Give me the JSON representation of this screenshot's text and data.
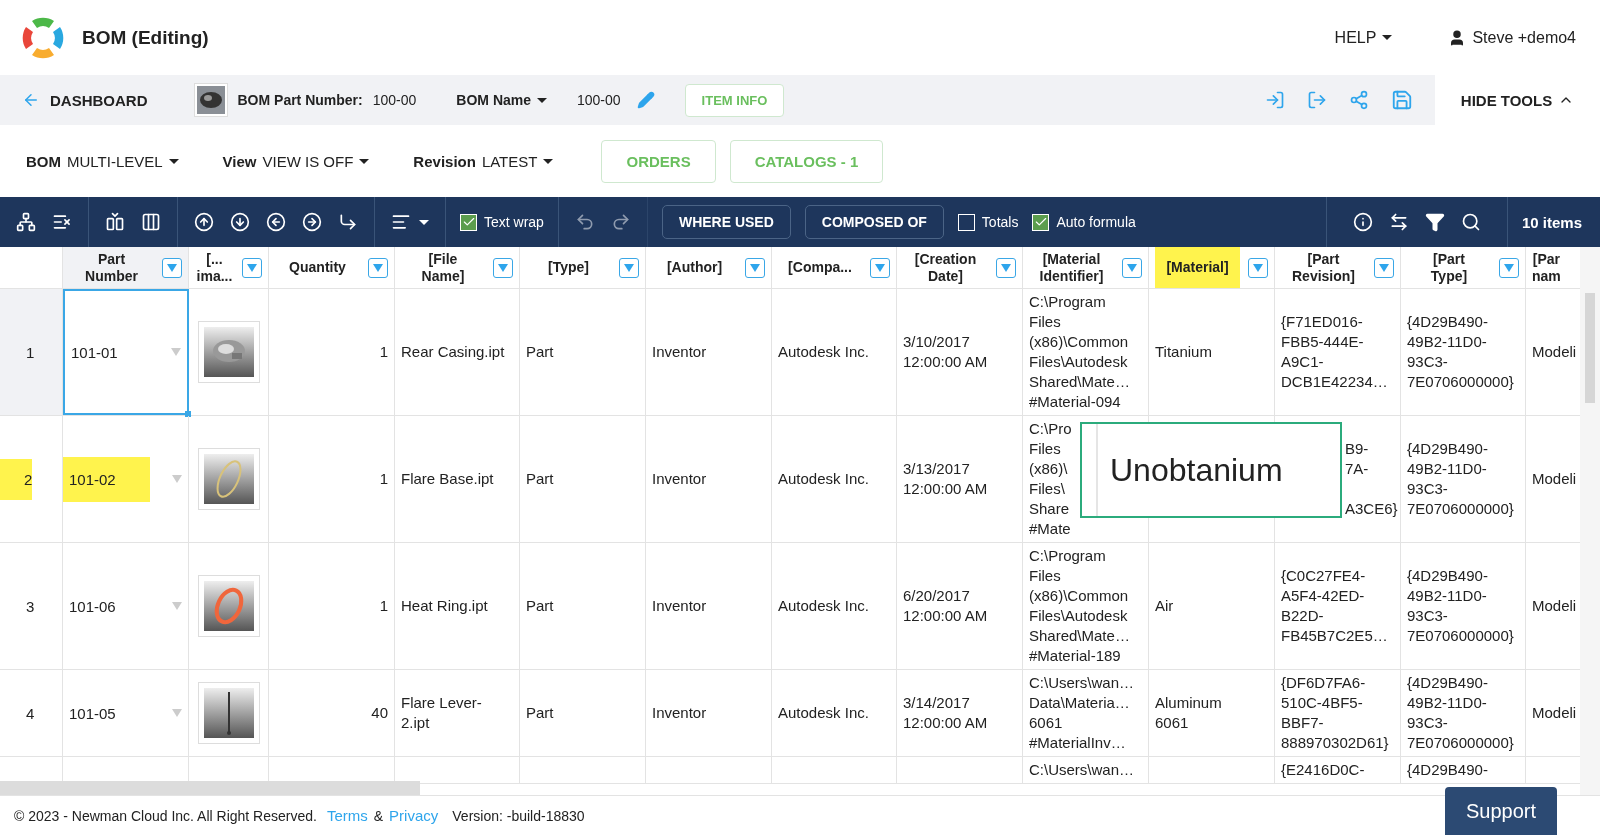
{
  "header": {
    "title": "BOM (Editing)",
    "help": "HELP",
    "user": "Steve +demo4"
  },
  "infobar": {
    "back": "DASHBOARD",
    "part_number_label": "BOM Part Number:",
    "part_number": "100-00",
    "bom_name_label": "BOM Name",
    "bom_name": "100-00",
    "item_info": "ITEM INFO",
    "hide_tools": "HIDE TOOLS"
  },
  "selectors": [
    {
      "label": "BOM",
      "value": "MULTI-LEVEL"
    },
    {
      "label": "View",
      "value": "VIEW IS OFF"
    },
    {
      "label": "Revision",
      "value": "LATEST"
    }
  ],
  "view_buttons": [
    "ORDERS",
    "CATALOGS - 1"
  ],
  "toolbar": {
    "text_wrap": {
      "label": "Text wrap",
      "checked": true
    },
    "where_used": "WHERE USED",
    "composed_of": "COMPOSED OF",
    "totals": {
      "label": "Totals",
      "checked": false
    },
    "auto_formula": {
      "label": "Auto formula",
      "checked": true
    },
    "items_count": "10 items"
  },
  "table": {
    "columns": [
      {
        "label": "Part\nNumber",
        "highlighted": false
      },
      {
        "label": "[...\nima...",
        "highlighted": false
      },
      {
        "label": "Quantity",
        "highlighted": false
      },
      {
        "label": "[File\nName]",
        "highlighted": false
      },
      {
        "label": "[Type]",
        "highlighted": false
      },
      {
        "label": "[Author]",
        "highlighted": false
      },
      {
        "label": "[Compa...",
        "highlighted": false
      },
      {
        "label": "[Creation\nDate]",
        "highlighted": false
      },
      {
        "label": "[Material\nIdentifier]",
        "highlighted": false
      },
      {
        "label": "[Material]",
        "highlighted": true
      },
      {
        "label": "[Part\nRevision]",
        "highlighted": false
      },
      {
        "label": "[Part\nType]",
        "highlighted": false
      },
      {
        "label": "[Par\nnam",
        "highlighted": false
      }
    ],
    "rows": [
      {
        "number": "1",
        "selected": true,
        "highlighted": false,
        "image": true,
        "cells": [
          "101-01",
          null,
          "1",
          "Rear Casing.ipt",
          "Part",
          "Inventor",
          "Autodesk Inc.",
          "3/10/2017\n12:00:00 AM",
          "C:\\Program\nFiles\n(x86)\\Common\nFiles\\Autodesk\nShared\\Mate…\n#Material-094",
          "Titanium",
          "{F71ED016-\nFBB5-444E-\nA9C1-\nDCB1E42234…",
          "{4D29B490-\n49B2-11D0-\n93C3-\n7E0706000000}",
          "Modeli"
        ]
      },
      {
        "number": "2",
        "selected": false,
        "highlighted": true,
        "image": true,
        "editor": {
          "value": "Unobtanium"
        },
        "cells": [
          "101-02",
          null,
          "1",
          "Flare Base.ipt",
          "Part",
          "Inventor",
          "Autodesk Inc.",
          "3/13/2017\n12:00:00 AM",
          "C:\\Pro\nFiles\n(x86)\\\nFiles\\\nShare\n#Mate",
          null,
          "B9-\n7A-\n\nA3CE6}",
          "{4D29B490-\n49B2-11D0-\n93C3-\n7E0706000000}",
          "Modeli"
        ]
      },
      {
        "number": "3",
        "selected": false,
        "highlighted": false,
        "image": true,
        "cells": [
          "101-06",
          null,
          "1",
          "Heat Ring.ipt",
          "Part",
          "Inventor",
          "Autodesk Inc.",
          "6/20/2017\n12:00:00 AM",
          "C:\\Program\nFiles\n(x86)\\Common\nFiles\\Autodesk\nShared\\Mate…\n#Material-189",
          "Air",
          "{C0C27FE4-\nA5F4-42ED-\nB22D-\nFB45B7C2E5…",
          "{4D29B490-\n49B2-11D0-\n93C3-\n7E0706000000}",
          "Modeli"
        ]
      },
      {
        "number": "4",
        "selected": false,
        "highlighted": false,
        "image": true,
        "cells": [
          "101-05",
          null,
          "40",
          "Flare Lever-\n2.ipt",
          "Part",
          "Inventor",
          "Autodesk Inc.",
          "3/14/2017\n12:00:00 AM",
          "C:\\Users\\wan…\nData\\Materia…\n6061\n#MaterialInv…",
          "Aluminum\n6061",
          "{DF6D7FA6-\n510C-4BF5-\nBBF7-\n888970302D61}",
          "{4D29B490-\n49B2-11D0-\n93C3-\n7E0706000000}",
          "Modeli"
        ]
      },
      {
        "cells": [
          null,
          null,
          null,
          null,
          null,
          null,
          null,
          null,
          "C:\\Users\\wan…",
          null,
          "{E2416D0C-",
          "{4D29B490-",
          null
        ]
      }
    ]
  },
  "footer": {
    "copyright": "© 2023 - Newman Cloud Inc. All Right Reserved.",
    "terms": "Terms",
    "amp": "&",
    "privacy": "Privacy",
    "version": "Version: -build-18830",
    "support": "Support"
  }
}
